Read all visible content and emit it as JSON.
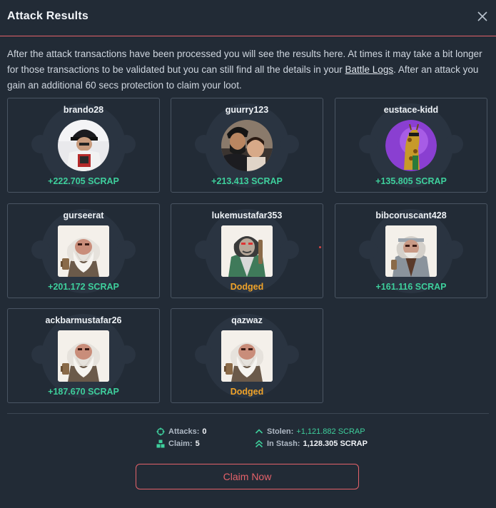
{
  "modal": {
    "title": "Attack Results",
    "close_icon": "close-icon"
  },
  "intro": {
    "part1": "After the attack transactions have been processed you will see the results here. At times it may take a bit longer for those transactions to be validated but you can still find all the details in your ",
    "link": "Battle Logs",
    "part2": ". After an attack you gain an additional 60 secs protection to claim your loot."
  },
  "results": [
    {
      "name": "brando28",
      "result": "+222.705 SCRAP",
      "status": "gain",
      "avatar": "photo-hat-man"
    },
    {
      "name": "guurry123",
      "result": "+213.413 SCRAP",
      "status": "gain",
      "avatar": "photo-man-child"
    },
    {
      "name": "eustace-kidd",
      "result": "+135.805 SCRAP",
      "status": "gain",
      "avatar": "giraffe-purple"
    },
    {
      "name": "gurseerat",
      "result": "+201.172 SCRAP",
      "status": "gain",
      "avatar": "ape-white-beard"
    },
    {
      "name": "lukemustafar353",
      "result": "Dodged",
      "status": "dodged",
      "avatar": "ape-green-coat"
    },
    {
      "name": "bibcoruscant428",
      "result": "+161.116 SCRAP",
      "status": "gain",
      "avatar": "ape-grey-coat"
    },
    {
      "name": "ackbarmustafar26",
      "result": "+187.670 SCRAP",
      "status": "gain",
      "avatar": "ape-white-beard"
    },
    {
      "name": "qazwaz",
      "result": "Dodged",
      "status": "dodged",
      "avatar": "ape-white-beard"
    }
  ],
  "stats": {
    "attacks_label": "Attacks:",
    "attacks_value": "0",
    "claim_label": "Claim:",
    "claim_value": "5",
    "stolen_label": "Stolen:",
    "stolen_value": "+1,121.882 SCRAP",
    "stash_label": "In Stash:",
    "stash_value": "1,128.305 SCRAP"
  },
  "claim_button": "Claim Now",
  "colors": {
    "background": "#222b36",
    "accent_red": "#e5626a",
    "gain_green": "#3ecf9c",
    "dodged_orange": "#f0a329"
  }
}
